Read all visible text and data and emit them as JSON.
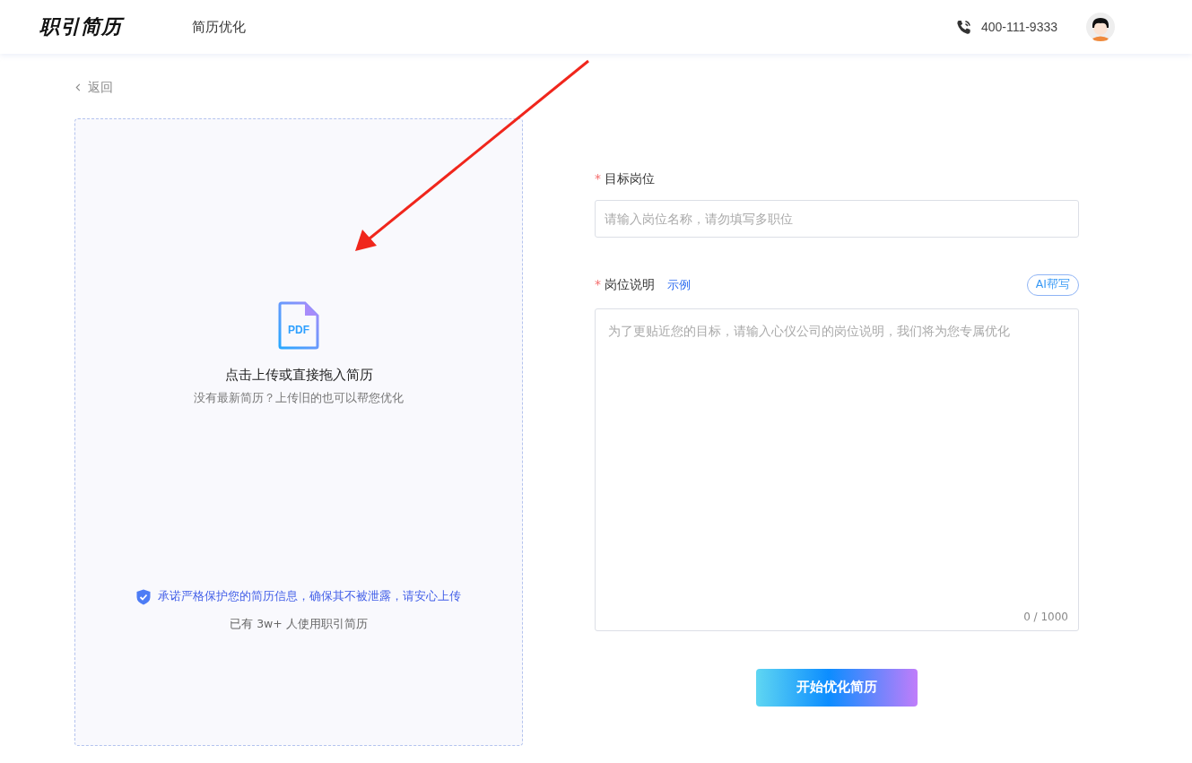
{
  "header": {
    "logo": "职引简历",
    "nav": [
      {
        "label": "简历优化",
        "selected": false
      }
    ],
    "phone": "400-111-9333"
  },
  "back": {
    "label": "返回"
  },
  "upload": {
    "file_badge": "PDF",
    "title": "点击上传或直接拖入简历",
    "subtitle": "没有最新简历？上传旧的也可以帮您优化",
    "privacy": "承诺严格保护您的简历信息，确保其不被泄露，请安心上传",
    "users": "已有 3w+ 人使用职引简历"
  },
  "form": {
    "required_mark": "*",
    "job_title": {
      "label": "目标岗位",
      "required": true,
      "placeholder": "请输入岗位名称，请勿填写多职位"
    },
    "job_description": {
      "label": "岗位说明",
      "required": true,
      "example_link": "示例",
      "ai_button": "AI帮写",
      "placeholder": "为了更贴近您的目标，请输入心仪公司的岗位说明，我们将为您专属优化",
      "counter": "0 / 1000"
    },
    "submit": "开始优化简历"
  }
}
